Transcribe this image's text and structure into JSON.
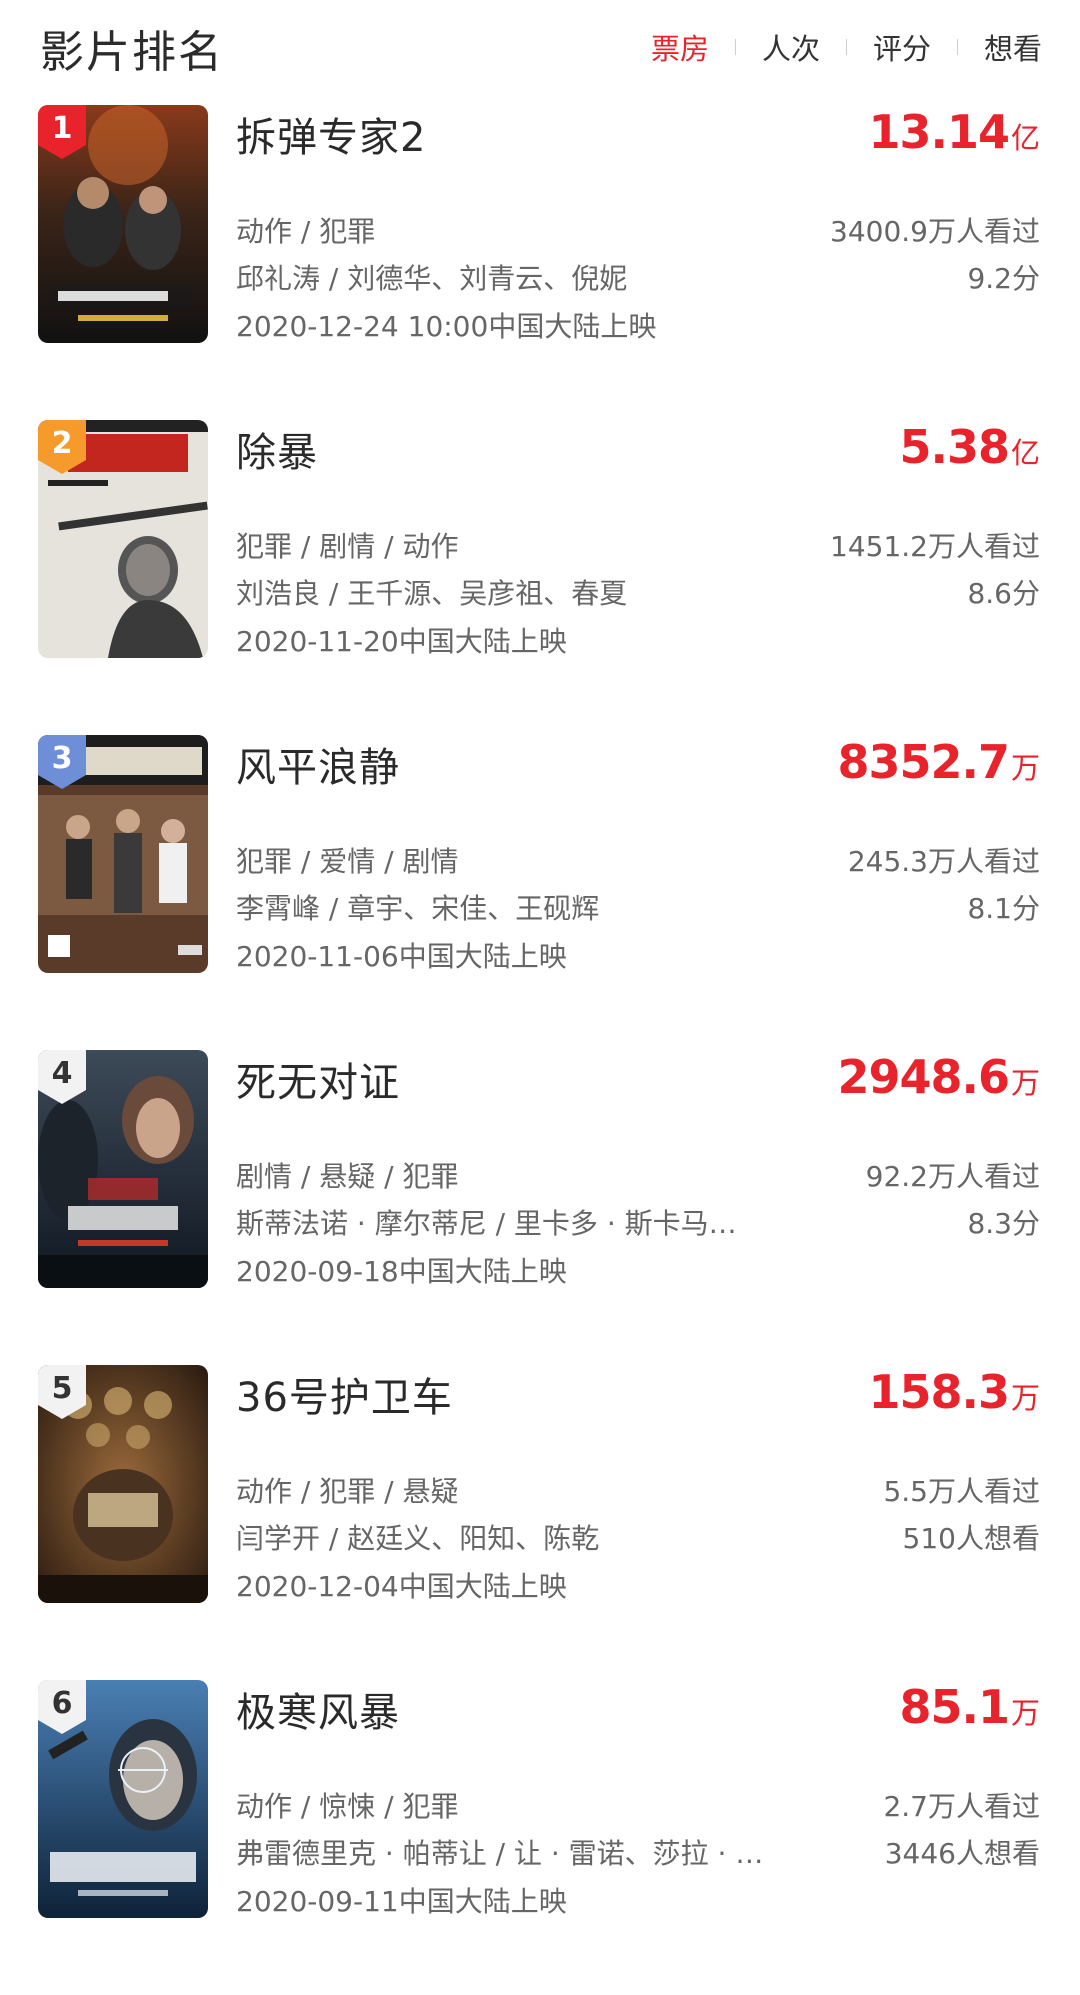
{
  "header": {
    "title": "影片排名",
    "tabs": [
      {
        "label": "票房",
        "active": true
      },
      {
        "label": "人次",
        "active": false
      },
      {
        "label": "评分",
        "active": false
      },
      {
        "label": "想看",
        "active": false
      }
    ]
  },
  "accent_color": "#e8232c",
  "movies": [
    {
      "rank": "1",
      "title": "拆弹专家2",
      "box_value": "13.14",
      "box_unit": "亿",
      "genres": "动作 / 犯罪",
      "people": "邱礼涛 / 刘德华、刘青云、倪妮",
      "release": "2020-12-24 10:00中国大陆上映",
      "stat1": "3400.9万人看过",
      "stat2": "9.2分",
      "rank_badge_color": "#e8232c"
    },
    {
      "rank": "2",
      "title": "除暴",
      "box_value": "5.38",
      "box_unit": "亿",
      "genres": "犯罪 / 剧情 / 动作",
      "people": "刘浩良 / 王千源、吴彦祖、春夏",
      "release": "2020-11-20中国大陆上映",
      "stat1": "1451.2万人看过",
      "stat2": "8.6分",
      "rank_badge_color": "#f59a2b"
    },
    {
      "rank": "3",
      "title": "风平浪静",
      "box_value": "8352.7",
      "box_unit": "万",
      "genres": "犯罪 / 爱情 / 剧情",
      "people": "李霄峰 / 章宇、宋佳、王砚辉",
      "release": "2020-11-06中国大陆上映",
      "stat1": "245.3万人看过",
      "stat2": "8.1分",
      "rank_badge_color": "#6e8fd8"
    },
    {
      "rank": "4",
      "title": "死无对证",
      "box_value": "2948.6",
      "box_unit": "万",
      "genres": "剧情 / 悬疑 / 犯罪",
      "people": "斯蒂法诺 · 摩尔蒂尼 / 里卡多 · 斯卡马…",
      "release": "2020-09-18中国大陆上映",
      "stat1": "92.2万人看过",
      "stat2": "8.3分",
      "rank_badge_color": "#f2f2f2"
    },
    {
      "rank": "5",
      "title": "36号护卫车",
      "box_value": "158.3",
      "box_unit": "万",
      "genres": "动作 / 犯罪 / 悬疑",
      "people": "闫学开 / 赵廷义、阳知、陈乾",
      "release": "2020-12-04中国大陆上映",
      "stat1": "5.5万人看过",
      "stat2": "510人想看",
      "rank_badge_color": "#f2f2f2"
    },
    {
      "rank": "6",
      "title": "极寒风暴",
      "box_value": "85.1",
      "box_unit": "万",
      "genres": "动作 / 惊悚 / 犯罪",
      "people": "弗雷德里克 · 帕蒂让 / 让 · 雷诺、莎拉 · …",
      "release": "2020-09-11中国大陆上映",
      "stat1": "2.7万人看过",
      "stat2": "3446人想看",
      "rank_badge_color": "#f2f2f2"
    }
  ]
}
